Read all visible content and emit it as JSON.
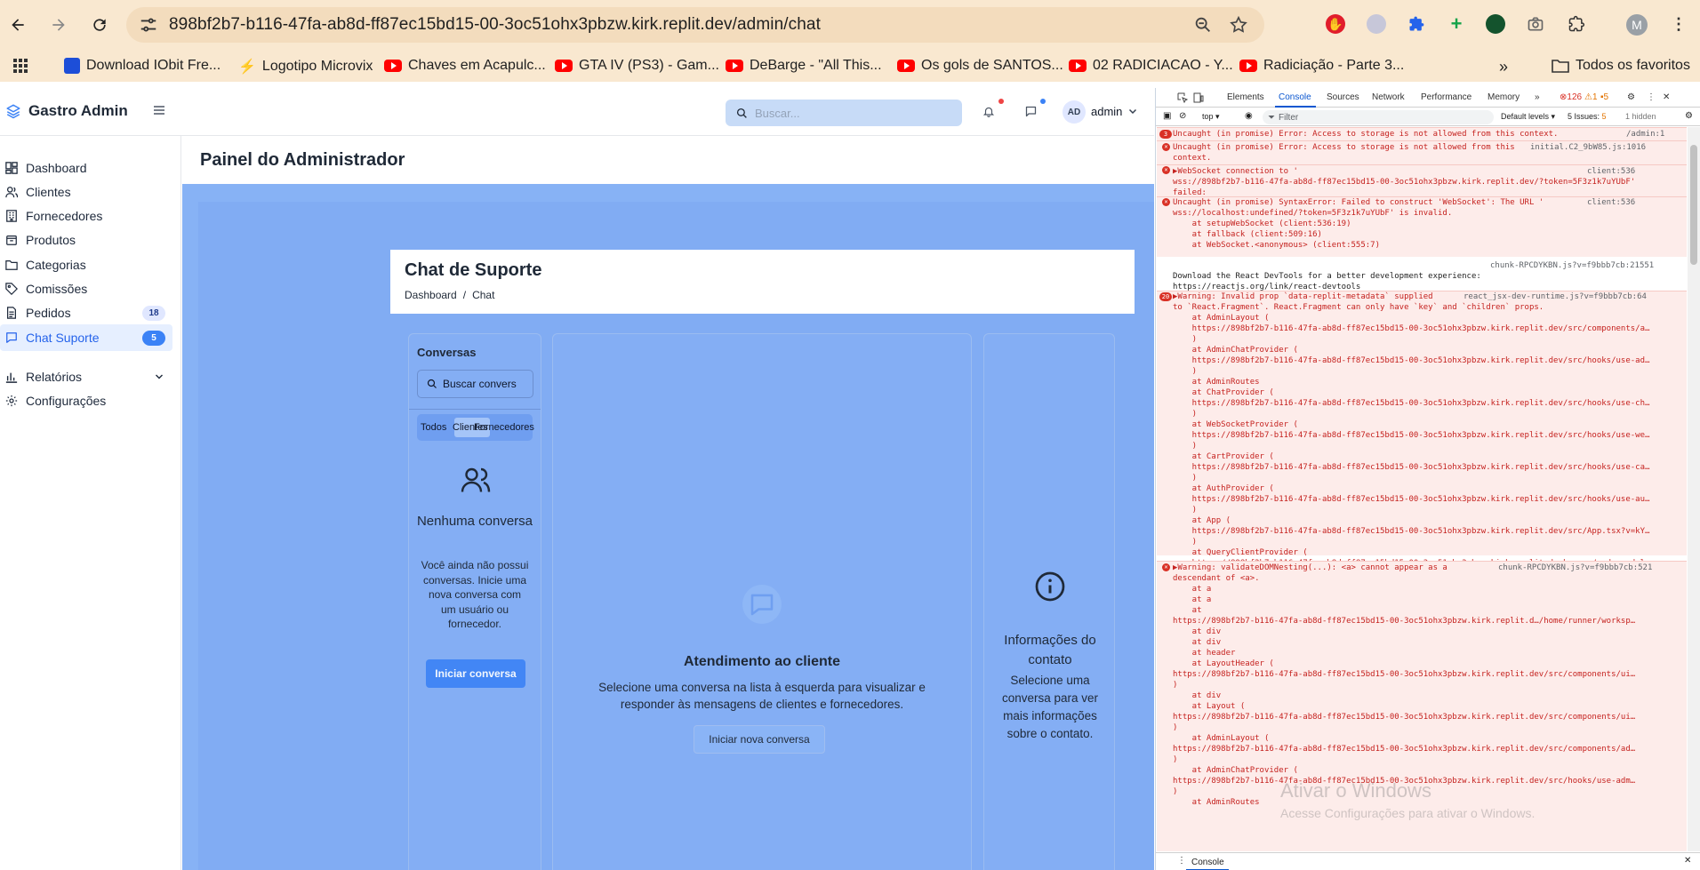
{
  "browser": {
    "url": "898bf2b7-b116-47fa-ab8d-ff87ec15bd15-00-3oc51ohx3pbzw.kirk.replit.dev/admin/chat",
    "profile_initial": "M",
    "bookmarks": [
      {
        "label": "Download IObit Fre...",
        "icon": "iobit-icon"
      },
      {
        "label": "Logotipo Microvix",
        "icon": "microvix-icon"
      },
      {
        "label": "Chaves em Acapulc...",
        "icon": "youtube-icon"
      },
      {
        "label": "GTA IV (PS3) - Gam...",
        "icon": "youtube-icon"
      },
      {
        "label": "DeBarge - \"All This...",
        "icon": "youtube-icon"
      },
      {
        "label": "Os gols de SANTOS...",
        "icon": "youtube-icon"
      },
      {
        "label": "02 RADICIACAO - Y...",
        "icon": "youtube-icon"
      },
      {
        "label": "Radiciação - Parte 3...",
        "icon": "youtube-icon"
      }
    ],
    "more_bookmarks": "»",
    "all_favorites": "Todos os favoritos"
  },
  "app": {
    "brand": "Gastro Admin",
    "search_placeholder": "Buscar...",
    "avatar_initials": "AD",
    "admin_name": "admin",
    "sidebar": [
      {
        "label": "Dashboard",
        "icon": "dashboard-icon"
      },
      {
        "label": "Clientes",
        "icon": "users-icon"
      },
      {
        "label": "Fornecedores",
        "icon": "building-icon"
      },
      {
        "label": "Produtos",
        "icon": "package-icon"
      },
      {
        "label": "Categorias",
        "icon": "folder-icon"
      },
      {
        "label": "Comissões",
        "icon": "tag-icon"
      },
      {
        "label": "Pedidos",
        "icon": "file-icon",
        "badge": "18"
      },
      {
        "label": "Chat Suporte",
        "icon": "chat-icon",
        "badge": "5",
        "active": true
      },
      {
        "label": "Relatórios",
        "icon": "bar-chart-icon",
        "expandable": true
      },
      {
        "label": "Configurações",
        "icon": "gear-icon"
      }
    ],
    "page_title": "Painel do Administrador",
    "chat": {
      "title": "Chat de Suporte",
      "breadcrumb": [
        "Dashboard",
        "/",
        "Chat"
      ],
      "conversations_label": "Conversas",
      "conv_search_placeholder": "Buscar convers",
      "tabs": [
        "Todos",
        "Clientes",
        "Fornecedores"
      ],
      "empty_title": "Nenhuma conversa",
      "empty_desc": "Você ainda não possui conversas. Inicie uma nova conversa com um usuário ou fornecedor.",
      "start_button": "Iniciar conversa",
      "center_title": "Atendimento ao cliente",
      "center_desc": "Selecione uma conversa na lista à esquerda para visualizar e responder às mensagens de clientes e fornecedores.",
      "new_conv_button": "Iniciar nova conversa",
      "info_title": "Informações do contato",
      "info_desc": "Selecione uma conversa para ver mais informações sobre o contato."
    }
  },
  "devtools": {
    "tabs": [
      "Elements",
      "Console",
      "Sources",
      "Network",
      "Performance",
      "Memory"
    ],
    "active_tab": "Console",
    "error_count": "126",
    "warning_count": "1",
    "issue_count_top": "5",
    "context": "top ▾",
    "filter_placeholder": "Filter",
    "levels": "Default levels ▾",
    "issues": "5 Issues:",
    "issues_count": "5",
    "hidden": "1 hidden",
    "messages": [
      {
        "type": "error",
        "text": "Uncaught (in promise) Error: Access to storage is not allowed from this context.",
        "src": "/admin:1",
        "count": "3"
      },
      {
        "type": "error",
        "text": "Uncaught (in promise) Error: Access to storage is not allowed from this\ncontext.",
        "src": "initial.C2_9bW85.js:1016"
      },
      {
        "type": "error",
        "text": "▶WebSocket connection to '\nwss://898bf2b7-b116-47fa-ab8d-ff87ec15bd15-00-3oc51ohx3pbzw.kirk.replit.dev/?token=5F3z1k7uYUbF'\nfailed:",
        "src": "client:536"
      },
      {
        "type": "error",
        "text": "Uncaught (in promise) SyntaxError: Failed to construct 'WebSocket': The URL '\nwss://localhost:undefined/?token=5F3z1k7uYUbF' is invalid.\n    at setupWebSocket (client:536:19)\n    at fallback (client:509:16)\n    at WebSocket.<anonymous> (client:555:7)",
        "src": "client:536"
      },
      {
        "type": "info",
        "text": "Download the React DevTools for a better development experience:\nhttps://reactjs.org/link/react-devtools",
        "src": "chunk-RPCDYKBN.js?v=f9bbb7cb:21551"
      },
      {
        "type": "error",
        "text": "▶Warning: Invalid prop `data-replit-metadata` supplied\nto `React.Fragment`. React.Fragment can only have `key` and `children` props.\n    at AdminLayout (\n    https://898bf2b7-b116-47fa-ab8d-ff87ec15bd15-00-3oc51ohx3pbzw.kirk.replit.dev/src/components/a…\n    )\n    at AdminChatProvider (\n    https://898bf2b7-b116-47fa-ab8d-ff87ec15bd15-00-3oc51ohx3pbzw.kirk.replit.dev/src/hooks/use-ad…\n    )\n    at AdminRoutes\n    at ChatProvider (\n    https://898bf2b7-b116-47fa-ab8d-ff87ec15bd15-00-3oc51ohx3pbzw.kirk.replit.dev/src/hooks/use-ch…\n    )\n    at WebSocketProvider (\n    https://898bf2b7-b116-47fa-ab8d-ff87ec15bd15-00-3oc51ohx3pbzw.kirk.replit.dev/src/hooks/use-we…\n    )\n    at CartProvider (\n    https://898bf2b7-b116-47fa-ab8d-ff87ec15bd15-00-3oc51ohx3pbzw.kirk.replit.dev/src/hooks/use-ca…\n    )\n    at AuthProvider (\n    https://898bf2b7-b116-47fa-ab8d-ff87ec15bd15-00-3oc51ohx3pbzw.kirk.replit.dev/src/hooks/use-au…\n    )\n    at App (\n    https://898bf2b7-b116-47fa-ab8d-ff87ec15bd15-00-3oc51ohx3pbzw.kirk.replit.dev/src/App.tsx?v=kY…\n    )\n    at QueryClientProvider (\n    https://898bf2b7-b116-47fa-ab8d-ff87ec15bd15-00-3oc51ohx3pbzw.kirk.replit.d…rkspace/node_modul…",
        "src": "react_jsx-dev-runtime.js?v=f9bbb7cb:64",
        "count": "20"
      },
      {
        "type": "error",
        "text": "▶Warning: validateDOMNesting(...): <a> cannot appear as a\ndescendant of <a>.\n    at a\n    at a\n    at\nhttps://898bf2b7-b116-47fa-ab8d-ff87ec15bd15-00-3oc51ohx3pbzw.kirk.replit.d…/home/runner/worksp…\n    at div\n    at div\n    at header\n    at LayoutHeader (\nhttps://898bf2b7-b116-47fa-ab8d-ff87ec15bd15-00-3oc51ohx3pbzw.kirk.replit.dev/src/components/ui…\n)\n    at div\n    at Layout (\nhttps://898bf2b7-b116-47fa-ab8d-ff87ec15bd15-00-3oc51ohx3pbzw.kirk.replit.dev/src/components/ui…\n)\n    at AdminLayout (\nhttps://898bf2b7-b116-47fa-ab8d-ff87ec15bd15-00-3oc51ohx3pbzw.kirk.replit.dev/src/components/ad…\n)\n    at AdminChatProvider (\nhttps://898bf2b7-b116-47fa-ab8d-ff87ec15bd15-00-3oc51ohx3pbzw.kirk.replit.dev/src/hooks/use-adm…\n)\n    at AdminRoutes",
        "src": "chunk-RPCDYKBN.js?v=f9bbb7cb:521"
      }
    ],
    "drawer_tab": "Console"
  },
  "watermark": {
    "line1": "Ativar o Windows",
    "line2": "Acesse Configurações para ativar o Windows."
  }
}
